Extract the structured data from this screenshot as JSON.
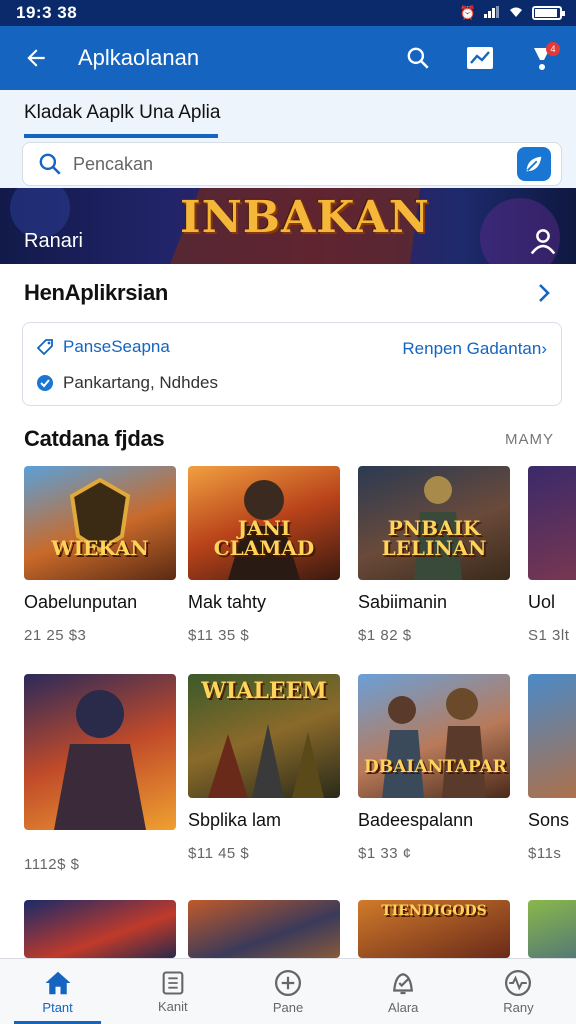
{
  "status_bar": {
    "time": "19:3 38"
  },
  "app_bar": {
    "title": "Aplkaolanan",
    "notification_count": "4"
  },
  "sub_header": {
    "tab_label": "Kladak Aaplk Una Aplia",
    "search_placeholder": "Pencakan"
  },
  "banner": {
    "title": "INBAKAN",
    "label": "Ranari"
  },
  "section1": {
    "title": "HenAplikrsian",
    "item1": "PanseSeapna",
    "item2": "Pankartang, Ndhdes",
    "link": "Renpen Gadantan›"
  },
  "section2": {
    "title": "Catdana fjdas",
    "see_all": "MAMY"
  },
  "cards": [
    {
      "title": "Oabelunputan",
      "price": "21 25 $3",
      "art": "WIEKAN"
    },
    {
      "title": "Mak tahty",
      "price": "$11 35 $",
      "art": "JANI CLAMAD"
    },
    {
      "title": "Sabiimanin",
      "price": "$1 82 $",
      "art": "PNBAIK LELINAN"
    },
    {
      "title": "Uol",
      "price": "S1 3lt",
      "art": ""
    },
    {
      "title": "",
      "price": "1112$ $",
      "art": ""
    },
    {
      "title": "Sbplika lam",
      "price": "$11 45 $",
      "art": "WIALEEM"
    },
    {
      "title": "Badeespalann",
      "price": "$1 33 ¢",
      "art": "DBAIANTAPAR"
    },
    {
      "title": "Sons",
      "price": "$11s",
      "art": ""
    },
    {
      "title": "",
      "price": "",
      "art": ""
    },
    {
      "title": "",
      "price": "",
      "art": ""
    },
    {
      "title": "",
      "price": "",
      "art": "TIENDIGODS"
    },
    {
      "title": "",
      "price": "",
      "art": ""
    }
  ],
  "bottom_nav": [
    {
      "label": "Ptant",
      "icon": "home-icon",
      "active": true
    },
    {
      "label": "Kanit",
      "icon": "list-icon",
      "active": false
    },
    {
      "label": "Pane",
      "icon": "plus-circle-icon",
      "active": false
    },
    {
      "label": "Alara",
      "icon": "bell-check-icon",
      "active": false
    },
    {
      "label": "Rany",
      "icon": "pulse-icon",
      "active": false
    }
  ],
  "colors": {
    "primary": "#1565c0",
    "status_bar": "#0a2a6b",
    "banner_text": "#f5b73a"
  }
}
